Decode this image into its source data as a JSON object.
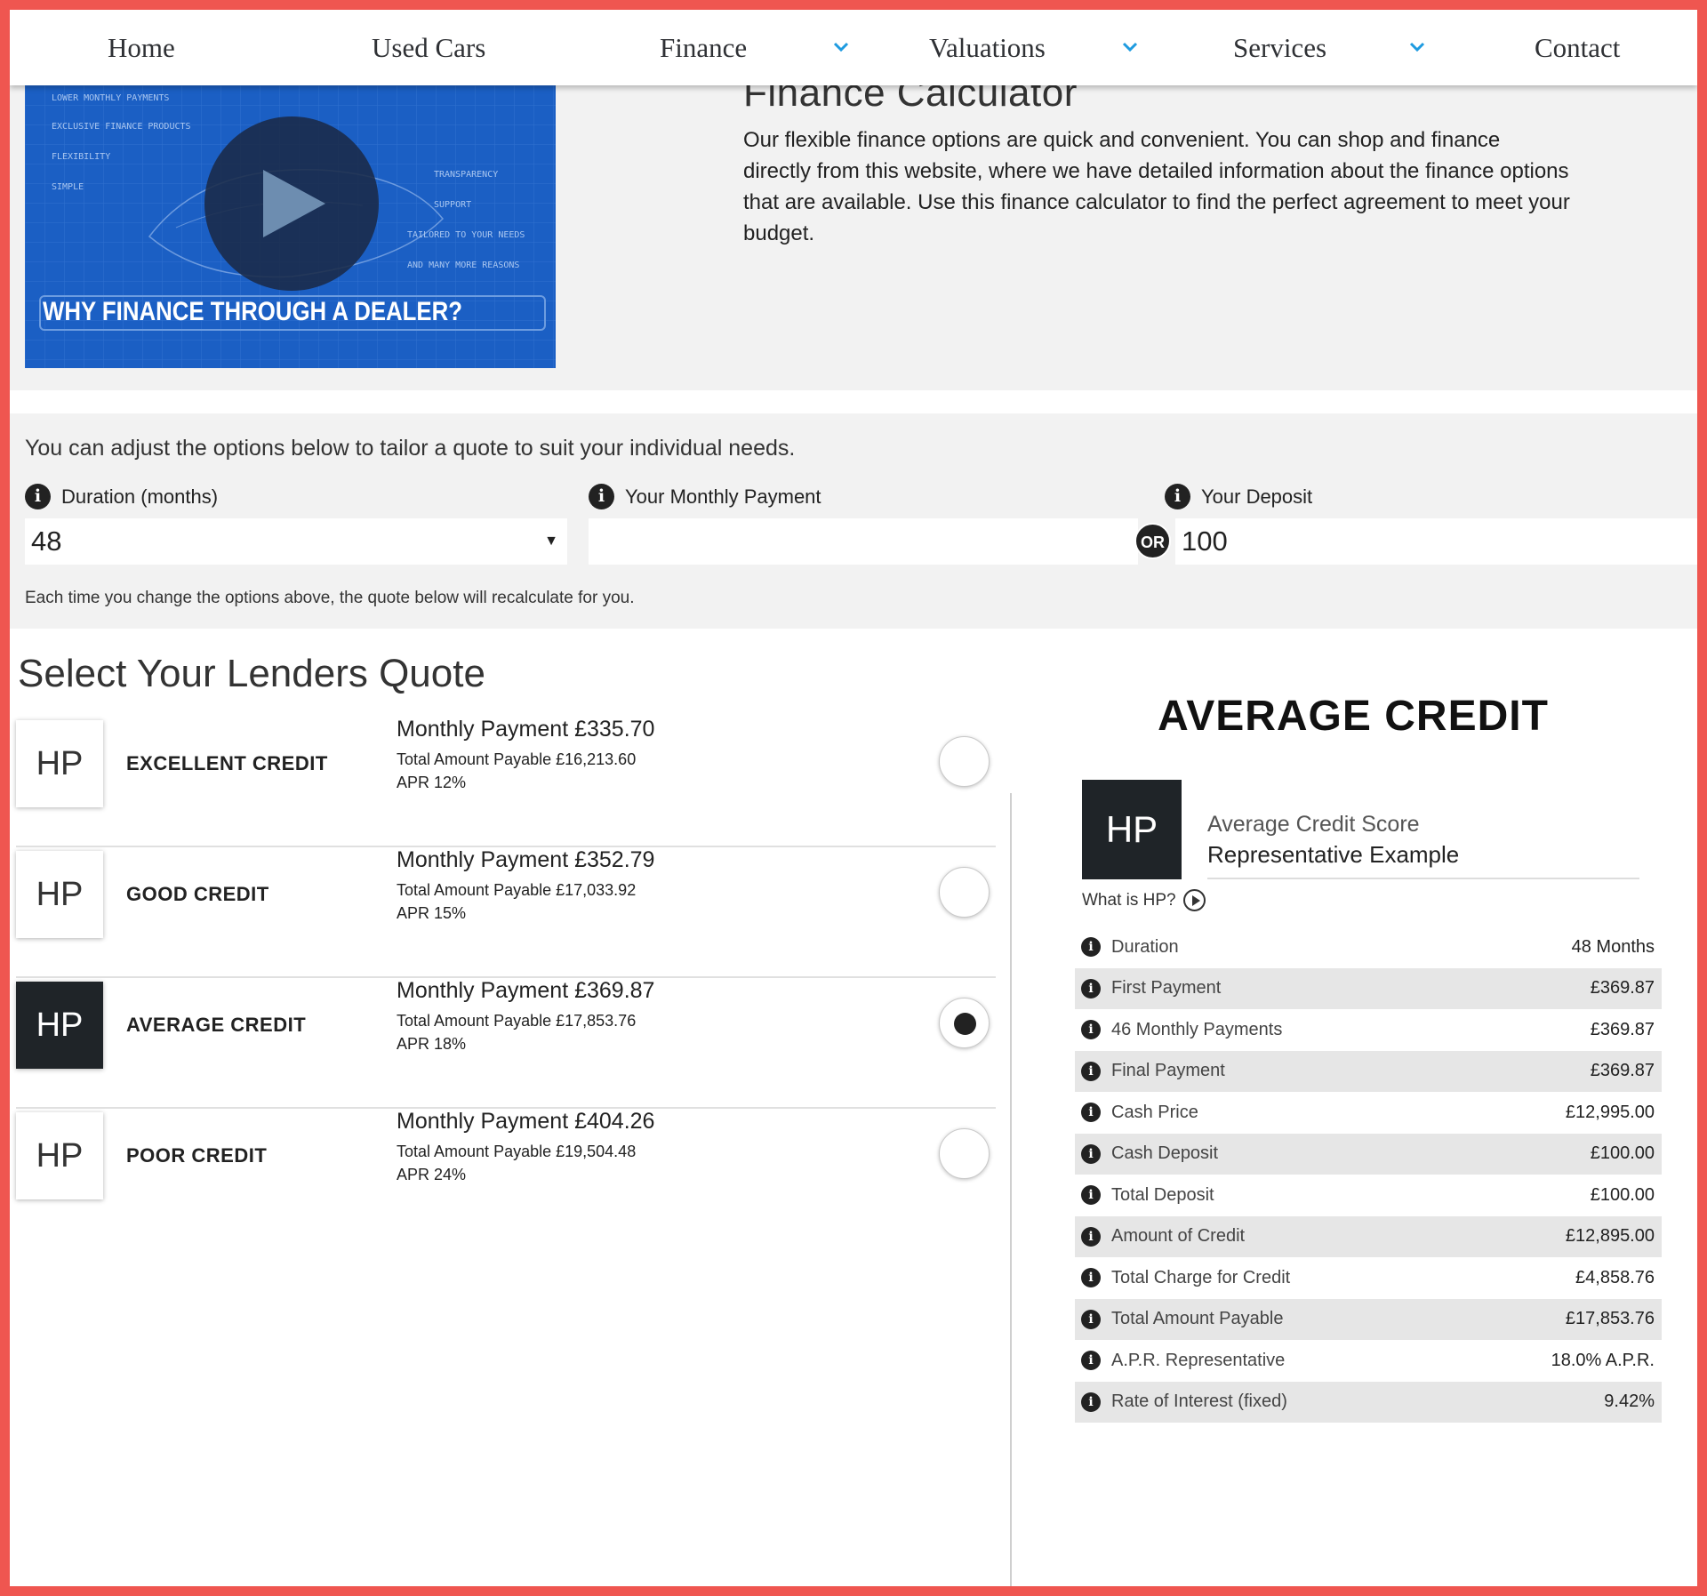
{
  "nav": {
    "items": [
      {
        "label": "Home",
        "has_dropdown": false
      },
      {
        "label": "Used Cars",
        "has_dropdown": false
      },
      {
        "label": "Finance",
        "has_dropdown": true
      },
      {
        "label": "Valuations",
        "has_dropdown": true
      },
      {
        "label": "Services",
        "has_dropdown": true
      },
      {
        "label": "Contact",
        "has_dropdown": false
      }
    ],
    "accent_color": "#1e9be0"
  },
  "intro": {
    "video_caption": "WHY FINANCE THROUGH A DEALER?",
    "video_features_left": [
      "LOWER MONTHLY PAYMENTS",
      "EXCLUSIVE FINANCE PRODUCTS",
      "FLEXIBILITY",
      "SIMPLE"
    ],
    "video_features_right": [
      "TRANSPARENCY",
      "SUPPORT",
      "TAILORED TO YOUR NEEDS",
      "AND MANY MORE REASONS"
    ],
    "title": "Finance Calculator",
    "text": "Our flexible finance options are quick and convenient. You can shop and finance directly from this website, where we have detailed information about the finance options that are available. Use this finance calculator to find the perfect agreement to meet your budget."
  },
  "options": {
    "help": "You can adjust the options below to tailor a quote to suit your individual needs.",
    "duration_label": "Duration (months)",
    "duration_value": "48",
    "monthly_label": "Your Monthly Payment",
    "monthly_value": "",
    "or_label": "OR",
    "deposit_label": "Your Deposit",
    "deposit_value": "100",
    "recalc_note": "Each time you change the options above, the quote below will recalculate for you."
  },
  "lenders": {
    "title": "Select Your Lenders Quote",
    "quotes": [
      {
        "badge": "HP",
        "label": "EXCELLENT CREDIT",
        "monthly": "Monthly Payment  £335.70",
        "total": "Total Amount Payable  £16,213.60",
        "apr": "APR  12%",
        "selected": false
      },
      {
        "badge": "HP",
        "label": "GOOD CREDIT",
        "monthly": "Monthly Payment  £352.79",
        "total": "Total Amount Payable  £17,033.92",
        "apr": "APR  15%",
        "selected": false
      },
      {
        "badge": "HP",
        "label": "AVERAGE CREDIT",
        "monthly": "Monthly Payment  £369.87",
        "total": "Total Amount Payable  £17,853.76",
        "apr": "APR  18%",
        "selected": true
      },
      {
        "badge": "HP",
        "label": "POOR CREDIT",
        "monthly": "Monthly Payment  £404.26",
        "total": "Total Amount Payable  £19,504.48",
        "apr": "APR  24%",
        "selected": false
      }
    ]
  },
  "summary": {
    "title": "AVERAGE CREDIT",
    "badge": "HP",
    "sub1": "Average Credit Score",
    "sub2": "Representative Example",
    "what_is": "What is HP?",
    "rows": [
      {
        "label": "Duration",
        "value": "48 Months"
      },
      {
        "label": "First Payment",
        "value": "£369.87"
      },
      {
        "label": "46 Monthly Payments",
        "value": "£369.87"
      },
      {
        "label": "Final Payment",
        "value": "£369.87"
      },
      {
        "label": "Cash Price",
        "value": "£12,995.00"
      },
      {
        "label": "Cash Deposit",
        "value": "£100.00"
      },
      {
        "label": "Total Deposit",
        "value": "£100.00"
      },
      {
        "label": "Amount of Credit",
        "value": "£12,895.00"
      },
      {
        "label": "Total Charge for Credit",
        "value": "£4,858.76"
      },
      {
        "label": "Total Amount Payable",
        "value": "£17,853.76"
      },
      {
        "label": "A.P.R. Representative",
        "value": "18.0% A.P.R."
      },
      {
        "label": "Rate of Interest (fixed)",
        "value": "9.42%"
      }
    ]
  },
  "info_icon": "info-icon"
}
